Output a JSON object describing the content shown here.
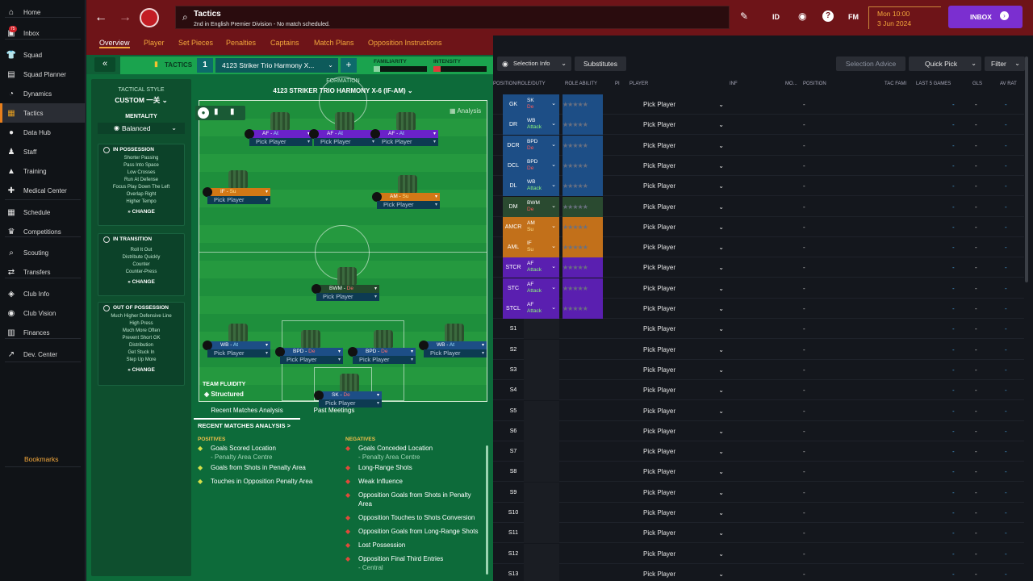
{
  "sidebar": {
    "items": [
      {
        "label": "Home",
        "icon": "home-icon",
        "glyph": "⌂"
      },
      {
        "label": "Inbox",
        "icon": "inbox-icon",
        "glyph": "▣",
        "badge": "75"
      },
      {
        "label": "Squad",
        "icon": "shirt-icon",
        "glyph": "👕"
      },
      {
        "label": "Squad Planner",
        "icon": "planner-icon",
        "glyph": "▤"
      },
      {
        "label": "Dynamics",
        "icon": "dynamics-icon",
        "glyph": "◔"
      },
      {
        "label": "Tactics",
        "icon": "tactics-icon",
        "glyph": "▦",
        "active": true
      },
      {
        "label": "Data Hub",
        "icon": "datahub-icon",
        "glyph": "●"
      },
      {
        "label": "Staff",
        "icon": "staff-icon",
        "glyph": "♟"
      },
      {
        "label": "Training",
        "icon": "training-icon",
        "glyph": "▲"
      },
      {
        "label": "Medical Center",
        "icon": "medical-icon",
        "glyph": "✚"
      },
      {
        "label": "Schedule",
        "icon": "schedule-icon",
        "glyph": "▦"
      },
      {
        "label": "Competitions",
        "icon": "trophy-icon",
        "glyph": "♛"
      },
      {
        "label": "Scouting",
        "icon": "scouting-icon",
        "glyph": "⌕"
      },
      {
        "label": "Transfers",
        "icon": "transfers-icon",
        "glyph": "⇄"
      },
      {
        "label": "Club Info",
        "icon": "clubinfo-icon",
        "glyph": "◈"
      },
      {
        "label": "Club Vision",
        "icon": "vision-icon",
        "glyph": "◉"
      },
      {
        "label": "Finances",
        "icon": "finances-icon",
        "glyph": "▥"
      },
      {
        "label": "Dev. Center",
        "icon": "devcenter-icon",
        "glyph": "↗"
      }
    ],
    "bookmarks": "Bookmarks"
  },
  "topbar": {
    "title": "Tactics",
    "subtitle": "2nd in English Premier Division - No match scheduled.",
    "id_label": "ID",
    "fm_label": "FM",
    "date_line1": "Mon 10:00",
    "date_line2": "3 Jun 2024",
    "inbox_label": "INBOX"
  },
  "tabs": [
    "Overview",
    "Player",
    "Set Pieces",
    "Penalties",
    "Captains",
    "Match Plans",
    "Opposition Instructions"
  ],
  "tactics_head": {
    "collapse": "«",
    "tactics_label": "TACTICS",
    "slot_number": "1",
    "tactic_name": "4123 Striker Trio Harmony X...",
    "add": "+",
    "familiarity": "FAMILIARITY",
    "intensity": "INTENSITY"
  },
  "style": {
    "tactical_style_label": "TACTICAL STYLE",
    "tactical_style_value": "CUSTOM 一关",
    "mentality_label": "MENTALITY",
    "mentality_value": "Balanced",
    "in_possession": {
      "title": "IN POSSESSION",
      "lines": [
        "Shorter Passing",
        "Pass Into Space",
        "Low Crosses",
        "Run At Defense",
        "Focus Play Down The Left",
        "Overlap Right",
        "Higher Tempo"
      ]
    },
    "in_transition": {
      "title": "IN TRANSITION",
      "lines": [
        "Roll It Out",
        "Distribute Quickly",
        "Counter",
        "Counter-Press"
      ]
    },
    "out_of_possession": {
      "title": "OUT OF POSSESSION",
      "lines": [
        "Much Higher Defensive Line",
        "High Press",
        "Much More Often",
        "Prevent Short GK",
        "Distribution",
        "Get Stuck In",
        "Step Up More"
      ]
    },
    "change_label": "CHANGE"
  },
  "formation": {
    "label": "FORMATION",
    "name": "4123 STRIKER TRIO HARMONY X-6 (IF-AM)",
    "analysis_label": "Analysis",
    "fluidity_label": "TEAM FLUIDITY",
    "fluidity_value": "Structured",
    "pick_label": "Pick Player",
    "slots": [
      {
        "role": "AF",
        "duty": "At",
        "cls": "at"
      },
      {
        "role": "AF",
        "duty": "At",
        "cls": "at"
      },
      {
        "role": "AF",
        "duty": "At",
        "cls": "at"
      },
      {
        "role": "IF",
        "duty": "Su",
        "cls": "su"
      },
      {
        "role": "AM",
        "duty": "Su",
        "cls": "su"
      },
      {
        "role": "BWM",
        "duty": "De",
        "cls": "bwm"
      },
      {
        "role": "WB",
        "duty": "At",
        "cls": "de"
      },
      {
        "role": "BPD",
        "duty": "De",
        "cls": "de"
      },
      {
        "role": "BPD",
        "duty": "De",
        "cls": "de"
      },
      {
        "role": "WB",
        "duty": "At",
        "cls": "de"
      },
      {
        "role": "SK",
        "duty": "De",
        "cls": "de"
      }
    ]
  },
  "analysis": {
    "tab_recent": "Recent Matches Analysis",
    "tab_past": "Past Meetings",
    "section_title": "RECENT MATCHES ANALYSIS >",
    "positives_title": "POSITIVES",
    "negatives_title": "NEGATIVES",
    "positives": [
      {
        "text": "Goals Scored Location",
        "sub": "- Penalty Area Centre"
      },
      {
        "text": "Goals from Shots in Penalty Area",
        "sub": ""
      },
      {
        "text": "Touches in Opposition Penalty Area",
        "sub": ""
      }
    ],
    "negatives": [
      {
        "text": "Goals Conceded Location",
        "sub": "- Penalty Area Centre"
      },
      {
        "text": "Long-Range Shots",
        "sub": ""
      },
      {
        "text": "Weak Influence",
        "sub": ""
      },
      {
        "text": "Opposition Goals from Shots in Penalty Area",
        "sub": ""
      },
      {
        "text": "Opposition Touches to Shots Conversion",
        "sub": ""
      },
      {
        "text": "Opposition Goals from Long-Range Shots",
        "sub": ""
      },
      {
        "text": "Lost Possession",
        "sub": ""
      },
      {
        "text": "Opposition Final Third Entries",
        "sub": "- Central"
      }
    ]
  },
  "right_toolbar": {
    "selection_info": "Selection Info",
    "substitutes": "Substitutes",
    "selection_advice": "Selection Advice",
    "quick_pick": "Quick Pick",
    "filter": "Filter"
  },
  "table": {
    "headers": [
      "POSITION/ROLE/DUTY",
      "ROLE ABILITY",
      "PI",
      "PLAYER",
      "INF",
      "MO...",
      "POSITION",
      "TAC FAMI",
      "LAST 5 GAMES",
      "GLS",
      "AV RAT"
    ],
    "pick_label": "Pick Player",
    "rows": [
      {
        "pos": "GK",
        "role": "SK",
        "duty": "De",
        "cls": "gk"
      },
      {
        "pos": "DR",
        "role": "WB",
        "duty": "Attack",
        "cls": "de"
      },
      {
        "pos": "DCR",
        "role": "BPD",
        "duty": "De",
        "cls": "de"
      },
      {
        "pos": "DCL",
        "role": "BPD",
        "duty": "De",
        "cls": "de"
      },
      {
        "pos": "DL",
        "role": "WB",
        "duty": "Attack",
        "cls": "de"
      },
      {
        "pos": "DM",
        "role": "BWM",
        "duty": "De",
        "cls": "dm"
      },
      {
        "pos": "AMCR",
        "role": "AM",
        "duty": "Su",
        "cls": "su"
      },
      {
        "pos": "AML",
        "role": "IF",
        "duty": "Su",
        "cls": "su"
      },
      {
        "pos": "STCR",
        "role": "AF",
        "duty": "Attack",
        "cls": "at"
      },
      {
        "pos": "STC",
        "role": "AF",
        "duty": "Attack",
        "cls": "at"
      },
      {
        "pos": "STCL",
        "role": "AF",
        "duty": "Attack",
        "cls": "at"
      },
      {
        "pos": "S1",
        "role": "",
        "duty": "",
        "cls": ""
      },
      {
        "pos": "S2",
        "role": "",
        "duty": "",
        "cls": ""
      },
      {
        "pos": "S3",
        "role": "",
        "duty": "",
        "cls": ""
      },
      {
        "pos": "S4",
        "role": "",
        "duty": "",
        "cls": ""
      },
      {
        "pos": "S5",
        "role": "",
        "duty": "",
        "cls": ""
      },
      {
        "pos": "S6",
        "role": "",
        "duty": "",
        "cls": ""
      },
      {
        "pos": "S7",
        "role": "",
        "duty": "",
        "cls": ""
      },
      {
        "pos": "S8",
        "role": "",
        "duty": "",
        "cls": ""
      },
      {
        "pos": "S9",
        "role": "",
        "duty": "",
        "cls": ""
      },
      {
        "pos": "S10",
        "role": "",
        "duty": "",
        "cls": ""
      },
      {
        "pos": "S11",
        "role": "",
        "duty": "",
        "cls": ""
      },
      {
        "pos": "S12",
        "role": "",
        "duty": "",
        "cls": ""
      },
      {
        "pos": "S13",
        "role": "",
        "duty": "",
        "cls": ""
      }
    ],
    "dash": "-",
    "stars": "★★★★★"
  },
  "colors": {
    "accent": "#e87f1c",
    "topbar": "#6e1418",
    "pitch": "#1e8f3c",
    "inbox_button": "#7b2fd0"
  }
}
